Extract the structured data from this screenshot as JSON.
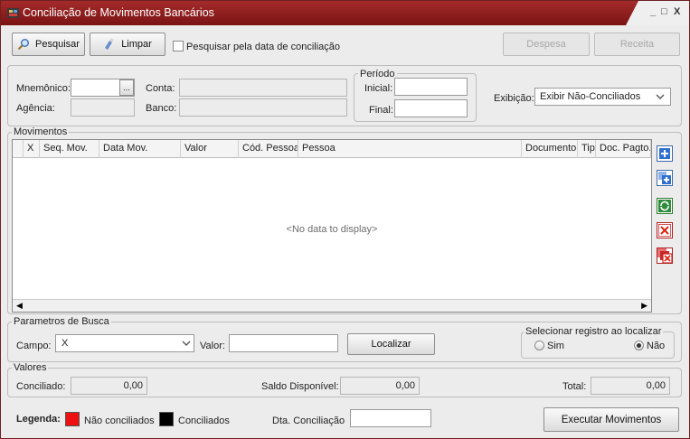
{
  "window": {
    "title": "Conciliação de Movimentos Bancários",
    "min": "_",
    "max": "□",
    "close": "X"
  },
  "toolbar": {
    "search_label": "Pesquisar",
    "clear_label": "Limpar",
    "search_by_date_label": "Pesquisar pela data de conciliação",
    "expense_label": "Despesa",
    "revenue_label": "Receita"
  },
  "filters": {
    "mnemonic_label": "Mnemônico:",
    "mnemonic_value": "",
    "ellipsis": "...",
    "account_label": "Conta:",
    "account_value": "",
    "agency_label": "Agência:",
    "agency_value": "",
    "bank_label": "Banco:",
    "bank_value": "",
    "period_title": "Período",
    "initial_label": "Inicial:",
    "initial_value": "",
    "final_label": "Final:",
    "final_value": "",
    "display_label": "Exibição:",
    "display_value": "Exibir Não-Conciliados"
  },
  "movements": {
    "title": "Movimentos",
    "columns": [
      "X",
      "Seq. Mov.",
      "Data Mov.",
      "Valor",
      "Cód. Pessoa",
      "Pessoa",
      "Documento",
      "Tipo",
      "Doc. Pagto."
    ],
    "empty_message": "<No data to display>"
  },
  "search_params": {
    "title": "Parametros de Busca",
    "field_label": "Campo:",
    "field_value": "X",
    "value_label": "Valor:",
    "value_value": "",
    "locate_label": "Localizar",
    "select_title": "Selecionar registro ao localizar",
    "yes_label": "Sim",
    "no_label": "Não",
    "selected": "Não"
  },
  "values": {
    "title": "Valores",
    "reconciled_label": "Conciliado:",
    "reconciled_value": "0,00",
    "available_label": "Saldo Disponível:",
    "available_value": "0,00",
    "total_label": "Total:",
    "total_value": "0,00"
  },
  "legend": {
    "title": "Legenda:",
    "not_reconciled_label": "Não conciliados",
    "not_reconciled_color": "#ee1111",
    "reconciled_label": "Conciliados",
    "reconciled_color": "#000000",
    "date_label": "Dta. Conciliação",
    "date_value": "",
    "execute_label": "Executar Movimentos"
  },
  "side_actions": [
    "add-icon",
    "add-copy-icon",
    "refresh-icon",
    "delete-icon",
    "delete-all-icon"
  ]
}
